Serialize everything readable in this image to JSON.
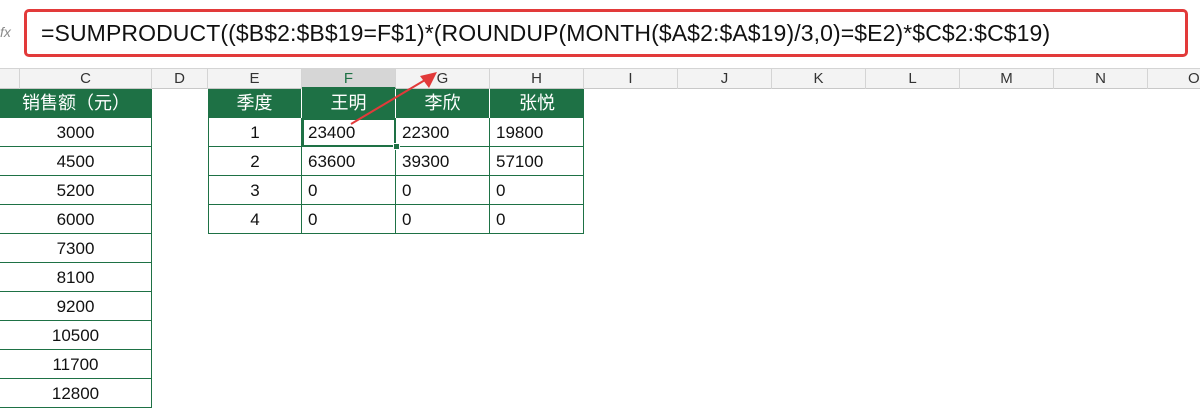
{
  "formula_bar": {
    "fx_label": "fx",
    "formula": "=SUMPRODUCT(($B$2:$B$19=F$1)*(ROUNDUP(MONTH($A$2:$A$19)/3,0)=$E2)*$C$2:$C$19)"
  },
  "columns": [
    "C",
    "D",
    "E",
    "F",
    "G",
    "H",
    "I",
    "J",
    "K",
    "L",
    "M",
    "N",
    "O"
  ],
  "active_column": "F",
  "sales_column": {
    "header": "销售额（元）",
    "values": [
      "3000",
      "4500",
      "5200",
      "6000",
      "7300",
      "8100",
      "9200",
      "10500",
      "11700",
      "12800"
    ]
  },
  "summary_table": {
    "headers": [
      "季度",
      "王明",
      "李欣",
      "张悦"
    ],
    "rows": [
      [
        "1",
        "23400",
        "22300",
        "19800"
      ],
      [
        "2",
        "63600",
        "39300",
        "57100"
      ],
      [
        "3",
        "0",
        "0",
        "0"
      ],
      [
        "4",
        "0",
        "0",
        "0"
      ]
    ]
  },
  "colors": {
    "header_green": "#1e7145",
    "annotation_red": "#e23a3a"
  }
}
